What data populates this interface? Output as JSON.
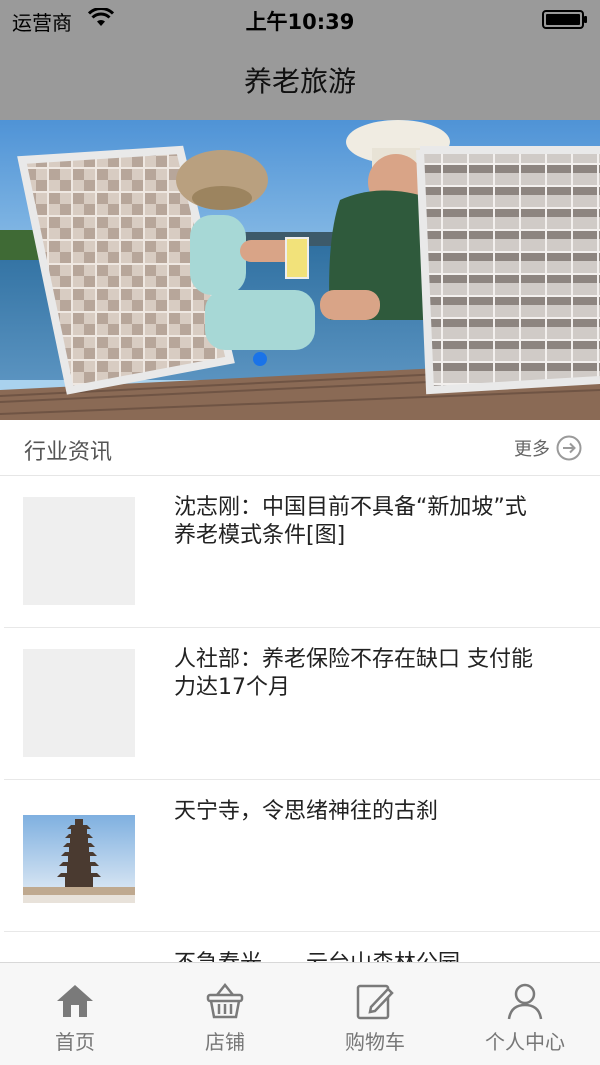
{
  "status_bar": {
    "carrier": "运营商",
    "time": "上午10:39",
    "icons": [
      "wifi-icon",
      "battery-icon"
    ]
  },
  "nav": {
    "title": "养老旅游"
  },
  "banner": {
    "image": "elderly-couple-on-lounge-chairs-by-lake",
    "active_page": 1,
    "accent_color": "#1a73e8"
  },
  "section": {
    "title": "行业资讯",
    "more_label": "更多",
    "more_icon": "arrow-right-circle-icon"
  },
  "news": [
    {
      "title": "沈志刚：中国目前不具备“新加坡”式养老模式条件[图]",
      "thumbnail": "placeholder"
    },
    {
      "title": "人社部：养老保险不存在缺口 支付能力达17个月",
      "thumbnail": "placeholder"
    },
    {
      "title": "天宁寺，令思绪神往的古刹",
      "thumbnail": "pagoda-photo"
    },
    {
      "title": "不急春光——云台山森林公园",
      "thumbnail": "none"
    }
  ],
  "tabs": [
    {
      "label": "首页",
      "icon": "home-icon"
    },
    {
      "label": "店铺",
      "icon": "basket-icon"
    },
    {
      "label": "购物车",
      "icon": "edit-icon"
    },
    {
      "label": "个人中心",
      "icon": "user-icon"
    }
  ],
  "colors": {
    "header_gray": "#9a9a9a",
    "tab_icon": "#7a7a7a"
  }
}
